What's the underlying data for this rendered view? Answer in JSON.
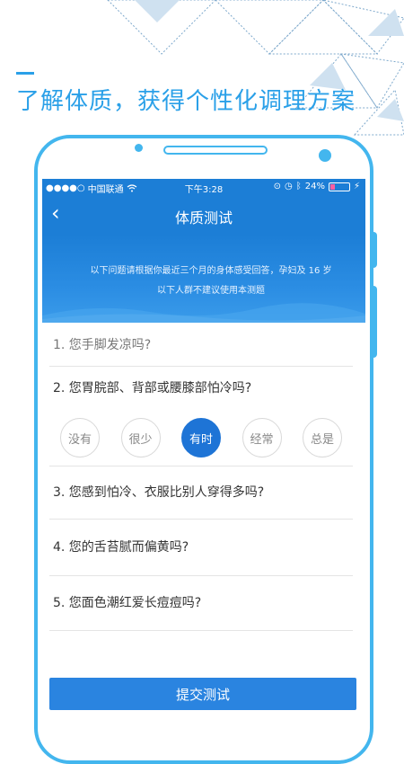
{
  "headline": "了解体质，获得个性化调理方案",
  "status_bar": {
    "carrier": "中国联通",
    "time": "下午3:28",
    "battery": "24%",
    "battery_level": 0.24,
    "signal_icon": "signal-dots-icon",
    "wifi_icon": "wifi-icon",
    "alarm_icon": "alarm-icon",
    "bluetooth_icon": "bluetooth-icon",
    "charging_icon": "charging-icon"
  },
  "nav": {
    "back_icon": "chevron-left-icon",
    "title": "体质测试"
  },
  "banner": {
    "line1": "以下问题请根据你最近三个月的身体感受回答，孕妇及 16 岁",
    "line2": "以下人群不建议使用本测题"
  },
  "questions": [
    {
      "text": "1. 您手脚发凉吗?"
    },
    {
      "text": "2. 您胃脘部、背部或腰膝部怕冷吗?"
    },
    {
      "text": "3. 您感到怕冷、衣服比别人穿得多吗?"
    },
    {
      "text": "4. 您的舌苔腻而偏黄吗?"
    },
    {
      "text": "5. 您面色潮红爱长痘痘吗?"
    }
  ],
  "options": [
    "没有",
    "很少",
    "有时",
    "经常",
    "总是"
  ],
  "selected_option": "有时",
  "submit_label": "提交测试",
  "colors": {
    "accent": "#2aa0e8",
    "header_blue": "#1c7ed6",
    "selected": "#1e74d6"
  }
}
